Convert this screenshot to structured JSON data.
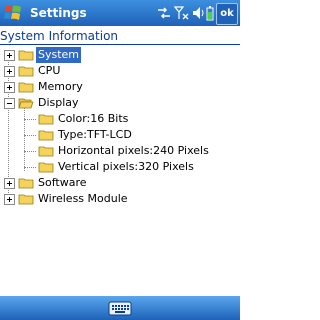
{
  "window": {
    "title": "Settings",
    "ok_label": "ok"
  },
  "status_icons": [
    "connectivity-icon",
    "signal-icon",
    "volume-icon",
    "battery-icon"
  ],
  "section_title": "System Information",
  "tree": [
    {
      "label": "System",
      "expanded": false,
      "selected": true
    },
    {
      "label": "CPU",
      "expanded": false
    },
    {
      "label": "Memory",
      "expanded": false
    },
    {
      "label": "Display",
      "expanded": true,
      "children": [
        "Color:16 Bits",
        "Type:TFT-LCD",
        "Horizontal pixels:240 Pixels",
        "Vertical pixels:320 Pixels"
      ]
    },
    {
      "label": "Software",
      "expanded": false
    },
    {
      "label": "Wireless Module",
      "expanded": false
    }
  ],
  "colors": {
    "titlebar": "#1f62b8",
    "section_text": "#0a3b9a",
    "selection": "#316ac5",
    "folder": "#f5d35a"
  }
}
